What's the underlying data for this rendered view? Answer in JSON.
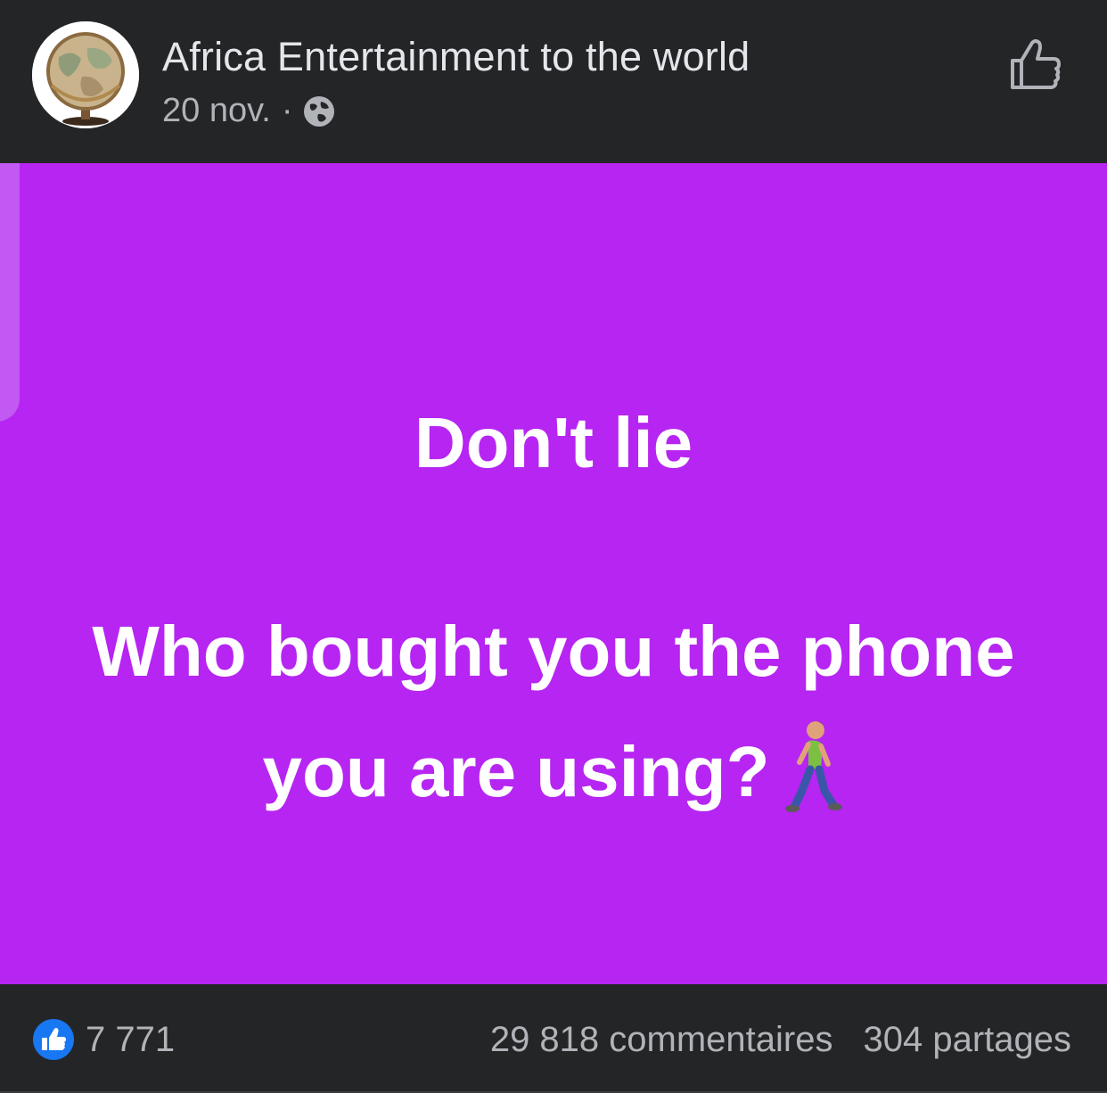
{
  "header": {
    "page_name": "Africa Entertainment to the world",
    "date": "20 nov.",
    "separator": "·",
    "audience_icon": "globe-icon",
    "avatar_icon": "world-globe-avatar",
    "like_icon": "thumbs-up-outline-icon"
  },
  "content": {
    "background_color": "#b625f1",
    "line_1": "Don't lie",
    "line_2": "Who bought you the phone",
    "line_3": "you are using?",
    "emoji_icon": "person-walking-emoji"
  },
  "footer": {
    "reactions_icon": "like-reaction-icon",
    "reactions_count": "7 771",
    "comments": "29 818 commentaires",
    "shares": "304 partages"
  },
  "colors": {
    "page_bg": "#242526",
    "primary_text": "#e4e6eb",
    "secondary_text": "#b0b3b8",
    "like_blue": "#1877f2"
  }
}
